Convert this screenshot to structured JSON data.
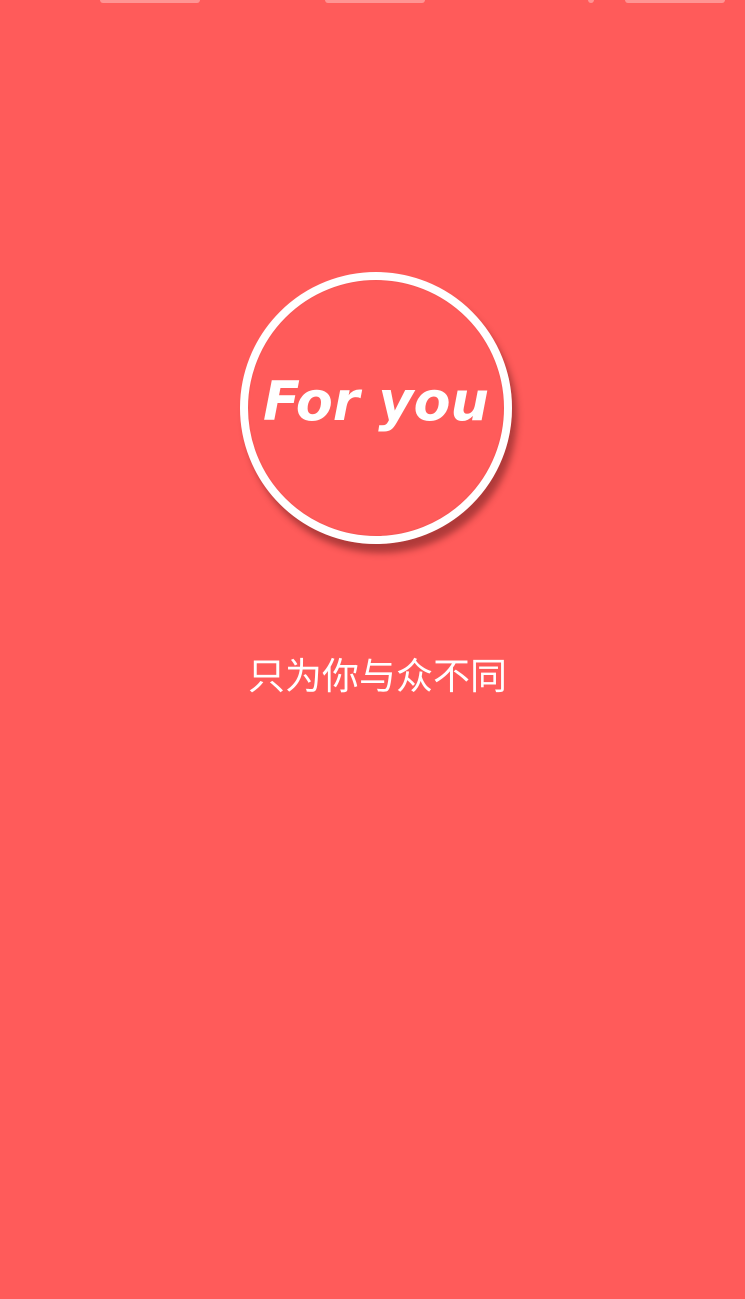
{
  "theme": {
    "background": "#ff5b5a",
    "foreground": "#ffffff"
  },
  "logo": {
    "text": "For you"
  },
  "slogan": {
    "text": "只为你与众不同"
  }
}
